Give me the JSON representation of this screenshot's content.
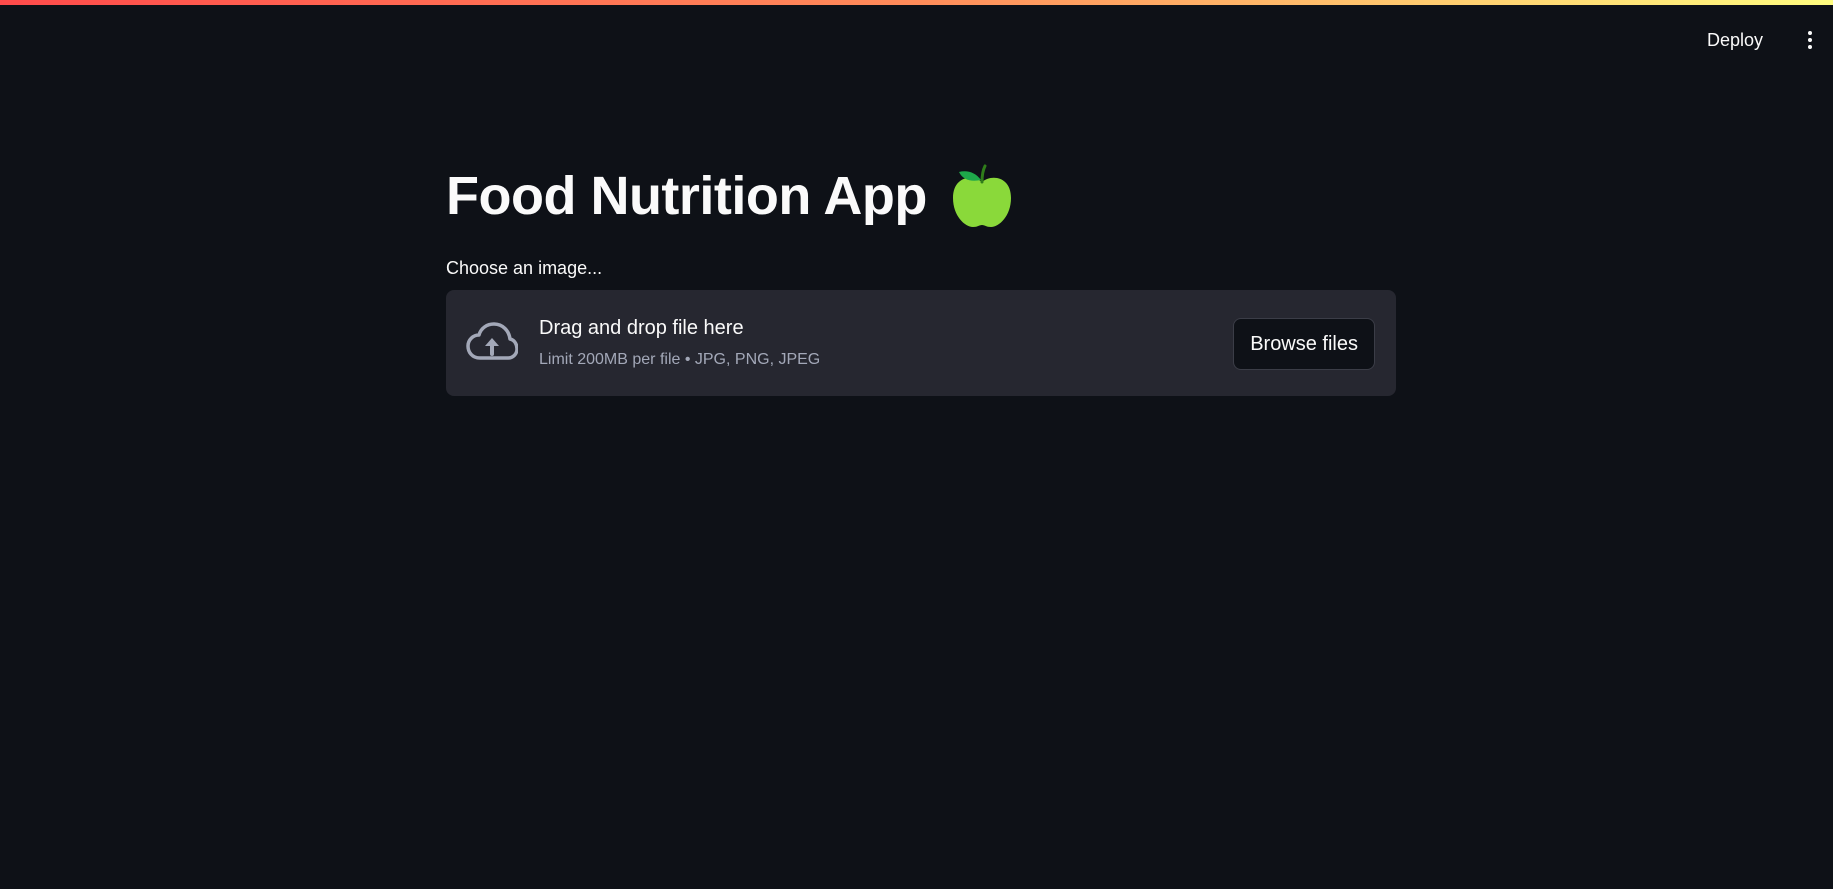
{
  "header": {
    "deploy_label": "Deploy",
    "menu_icon": "vertical-ellipsis-icon"
  },
  "main": {
    "title": "Food Nutrition App",
    "title_icon": "green-apple-icon",
    "uploader": {
      "label": "Choose an image...",
      "icon": "cloud-upload-icon",
      "dropzone_title": "Drag and drop file here",
      "dropzone_limit": "Limit 200MB per file • JPG, PNG, JPEG",
      "browse_label": "Browse files"
    }
  },
  "colors": {
    "background": "#0e1117",
    "dropzone_bg": "#262730",
    "text": "#fafafa",
    "muted_text": "#a3a8b8",
    "accent_gradient_start": "#ff4b4b",
    "accent_gradient_end": "#fffd80",
    "apple_green": "#8ad93a"
  }
}
